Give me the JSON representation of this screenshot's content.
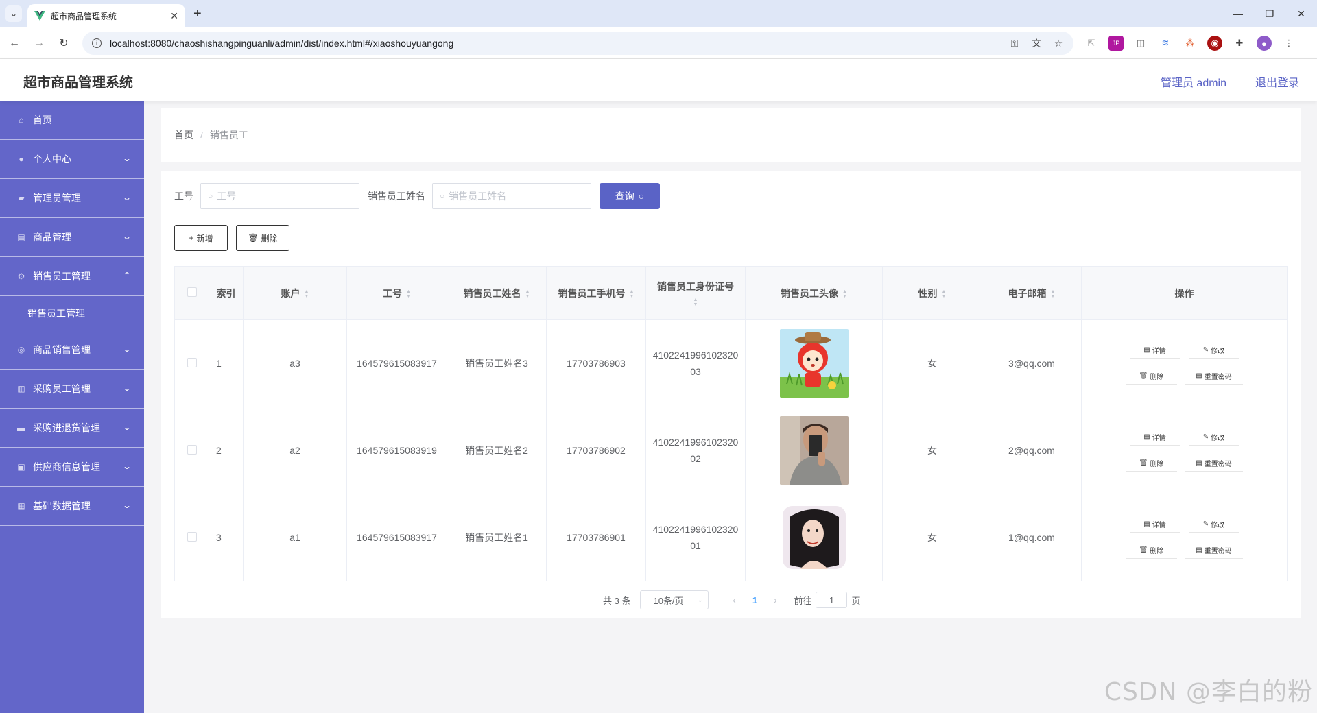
{
  "browser": {
    "tab_title": "超市商品管理系统",
    "url": "localhost:8080/chaoshishangpinguanli/admin/dist/index.html#/xiaoshouyuangong"
  },
  "header": {
    "title": "超市商品管理系统",
    "user": "管理员 admin",
    "logout": "退出登录"
  },
  "sidebar": {
    "items": [
      {
        "label": "首页",
        "icon": "home-icon"
      },
      {
        "label": "个人中心",
        "icon": "user-icon",
        "arrow": "down"
      },
      {
        "label": "管理员管理",
        "icon": "admin-icon",
        "arrow": "down"
      },
      {
        "label": "商品管理",
        "icon": "goods-icon",
        "arrow": "down"
      },
      {
        "label": "销售员工管理",
        "icon": "gear-icon",
        "arrow": "up",
        "open": true
      },
      {
        "label": "销售员工管理",
        "sub": true
      },
      {
        "label": "商品销售管理",
        "icon": "sales-icon",
        "arrow": "down"
      },
      {
        "label": "采购员工管理",
        "icon": "chart-icon",
        "arrow": "down"
      },
      {
        "label": "采购进退货管理",
        "icon": "truck-icon",
        "arrow": "down"
      },
      {
        "label": "供应商信息管理",
        "icon": "supplier-icon",
        "arrow": "down"
      },
      {
        "label": "基础数据管理",
        "icon": "data-icon",
        "arrow": "down"
      }
    ]
  },
  "breadcrumb": {
    "home": "首页",
    "sep": "/",
    "current": "销售员工"
  },
  "search": {
    "label1": "工号",
    "placeholder1": "工号",
    "label2": "销售员工姓名",
    "placeholder2": "销售员工姓名",
    "query": "查询"
  },
  "actions": {
    "add": "新增",
    "delete": "删除"
  },
  "table": {
    "columns": [
      "索引",
      "账户",
      "工号",
      "销售员工姓名",
      "销售员工手机号",
      "销售员工身份证号",
      "销售员工头像",
      "性别",
      "电子邮箱",
      "操作"
    ],
    "rows": [
      {
        "index": "1",
        "account": "a3",
        "job_no": "164579615083917",
        "name": "销售员工姓名3",
        "phone": "17703786903",
        "id_card": "410224199610232003",
        "gender": "女",
        "email": "3@qq.com"
      },
      {
        "index": "2",
        "account": "a2",
        "job_no": "164579615083919",
        "name": "销售员工姓名2",
        "phone": "17703786902",
        "id_card": "410224199610232002",
        "gender": "女",
        "email": "2@qq.com"
      },
      {
        "index": "3",
        "account": "a1",
        "job_no": "164579615083917",
        "name": "销售员工姓名1",
        "phone": "17703786901",
        "id_card": "410224199610232001",
        "gender": "女",
        "email": "1@qq.com"
      }
    ],
    "ops": {
      "detail": "详情",
      "edit": "修改",
      "delete": "删除",
      "reset": "重置密码"
    }
  },
  "pagination": {
    "total": "共 3 条",
    "page_size": "10条/页",
    "current": "1",
    "goto": "前往",
    "goto_value": "1",
    "page_unit": "页"
  },
  "watermark": "CSDN @李白的粉",
  "colors": {
    "sidebar": "#6366c9",
    "accent": "#5a63c6",
    "page_bg": "#f4f4f6"
  }
}
